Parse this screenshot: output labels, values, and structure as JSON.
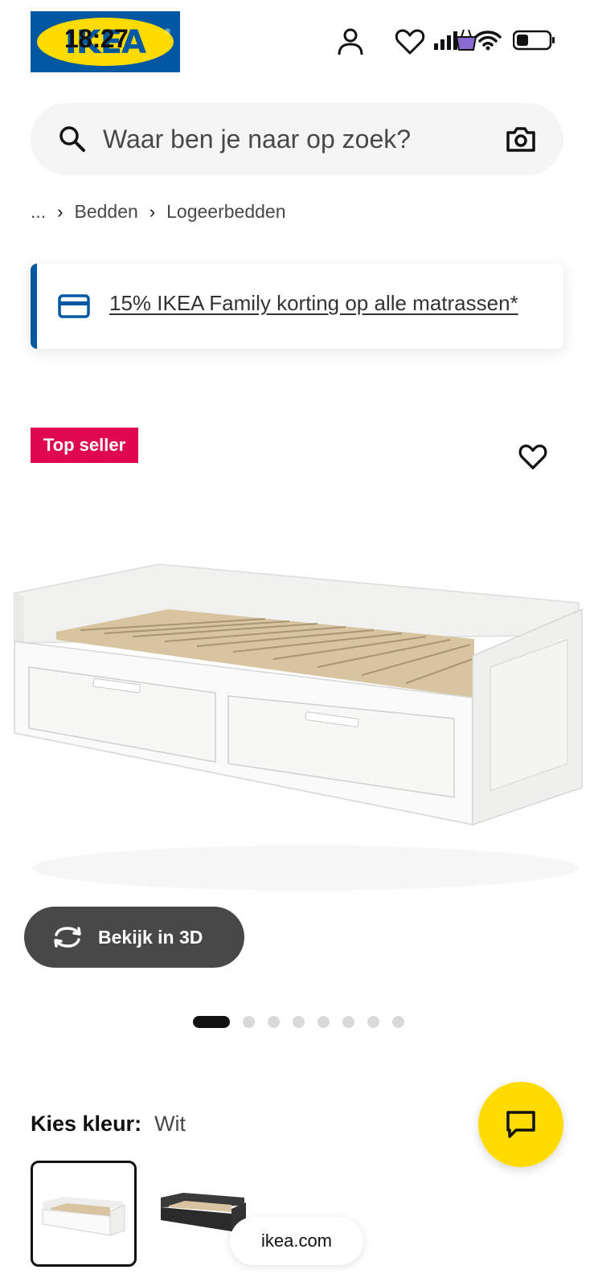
{
  "status_bar": {
    "time": "18:27"
  },
  "header": {
    "logo_text": "IKEA",
    "icons": [
      "user-icon",
      "heart-icon",
      "basket-icon"
    ]
  },
  "search": {
    "placeholder": "Waar ben je naar op zoek?"
  },
  "breadcrumb": {
    "ellipsis": "...",
    "items": [
      "Bedden",
      "Logeerbedden"
    ]
  },
  "promo": {
    "text": "15% IKEA Family korting op alle matrassen*"
  },
  "product": {
    "badge": "Top seller"
  },
  "view3d": {
    "label": "Bekijk in 3D"
  },
  "gallery": {
    "total": 8,
    "active_index": 0
  },
  "color": {
    "label": "Kies kleur:",
    "value": "Wit",
    "options": [
      "Wit",
      "Zwart"
    ]
  },
  "browser": {
    "url": "ikea.com"
  },
  "colors": {
    "ikea_blue": "#0058a3",
    "ikea_yellow": "#ffdb00",
    "badge_red": "#e00751",
    "dark_grey": "#484848"
  }
}
